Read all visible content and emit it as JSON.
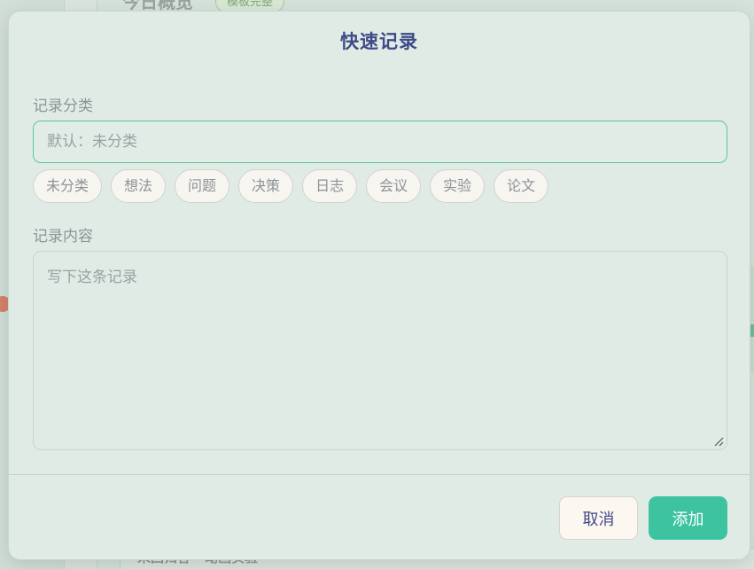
{
  "background": {
    "header_title": "今日概览",
    "header_badge": "模板完整",
    "footer_text": "未回归答 · 动画实验"
  },
  "modal": {
    "title": "快速记录",
    "category": {
      "label": "记录分类",
      "placeholder": "默认：未分类",
      "value": "",
      "chips": [
        "未分类",
        "想法",
        "问题",
        "决策",
        "日志",
        "会议",
        "实验",
        "论文"
      ]
    },
    "content": {
      "label": "记录内容",
      "placeholder": "写下这条记录",
      "value": ""
    },
    "buttons": {
      "cancel": "取消",
      "add": "添加"
    }
  },
  "colors": {
    "accent": "#3ec3a0",
    "input_focus_border": "#58c79a",
    "title": "#3f4a87",
    "modal_bg": "#e0ebe5"
  }
}
